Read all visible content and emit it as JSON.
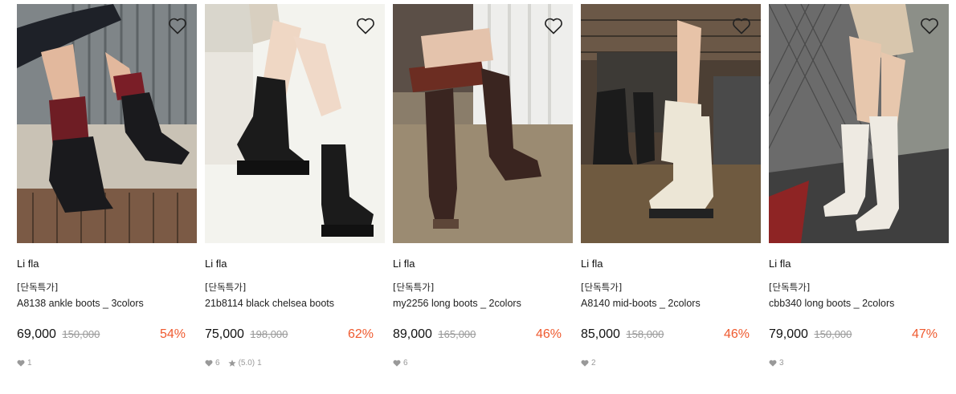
{
  "products": [
    {
      "brand": "Li fla",
      "tag": "[단독특가]",
      "name": "A8138 ankle boots _ 3colors",
      "price": "69,000",
      "original_price": "150,000",
      "discount": "54%",
      "likes": "1",
      "rating": null,
      "reviews": null,
      "wishlist_icon": "heart-outline-icon",
      "scene": {
        "bg": "#8a8f92",
        "accent": "#6e1d24",
        "boot": "#1a1a1d"
      }
    },
    {
      "brand": "Li fla",
      "tag": "[단독특가]",
      "name": "21b8114 black chelsea boots",
      "price": "75,000",
      "original_price": "198,000",
      "discount": "62%",
      "likes": "6",
      "rating": "(5.0)",
      "reviews": "1",
      "wishlist_icon": "heart-outline-icon",
      "scene": {
        "bg": "#f1f1ea",
        "accent": "#e8e4d8",
        "boot": "#1b1b1b"
      }
    },
    {
      "brand": "Li fla",
      "tag": "[단독특가]",
      "name": "my2256 long boots _ 2colors",
      "price": "89,000",
      "original_price": "165,000",
      "discount": "46%",
      "likes": "6",
      "rating": null,
      "reviews": null,
      "wishlist_icon": "heart-outline-icon",
      "scene": {
        "bg": "#8c7f6c",
        "accent": "#6a5a4a",
        "boot": "#3a2520"
      }
    },
    {
      "brand": "Li fla",
      "tag": "[단독특가]",
      "name": "A8140 mid-boots _ 2colors",
      "price": "85,000",
      "original_price": "158,000",
      "discount": "46%",
      "likes": "2",
      "rating": null,
      "reviews": null,
      "wishlist_icon": "heart-outline-icon",
      "scene": {
        "bg": "#5b4e40",
        "accent": "#3d3a36",
        "boot": "#ece6d6"
      }
    },
    {
      "brand": "Li fla",
      "tag": "[단독특가]",
      "name": "cbb340 long boots _ 2colors",
      "price": "79,000",
      "original_price": "150,000",
      "discount": "47%",
      "likes": "3",
      "rating": null,
      "reviews": null,
      "wishlist_icon": "heart-outline-icon",
      "scene": {
        "bg": "#6c6c6c",
        "accent": "#9e2b2b",
        "boot": "#eeeae2"
      }
    }
  ],
  "colors": {
    "discount": "#ef5a2f",
    "original_price": "#999999",
    "meta": "#999999"
  }
}
